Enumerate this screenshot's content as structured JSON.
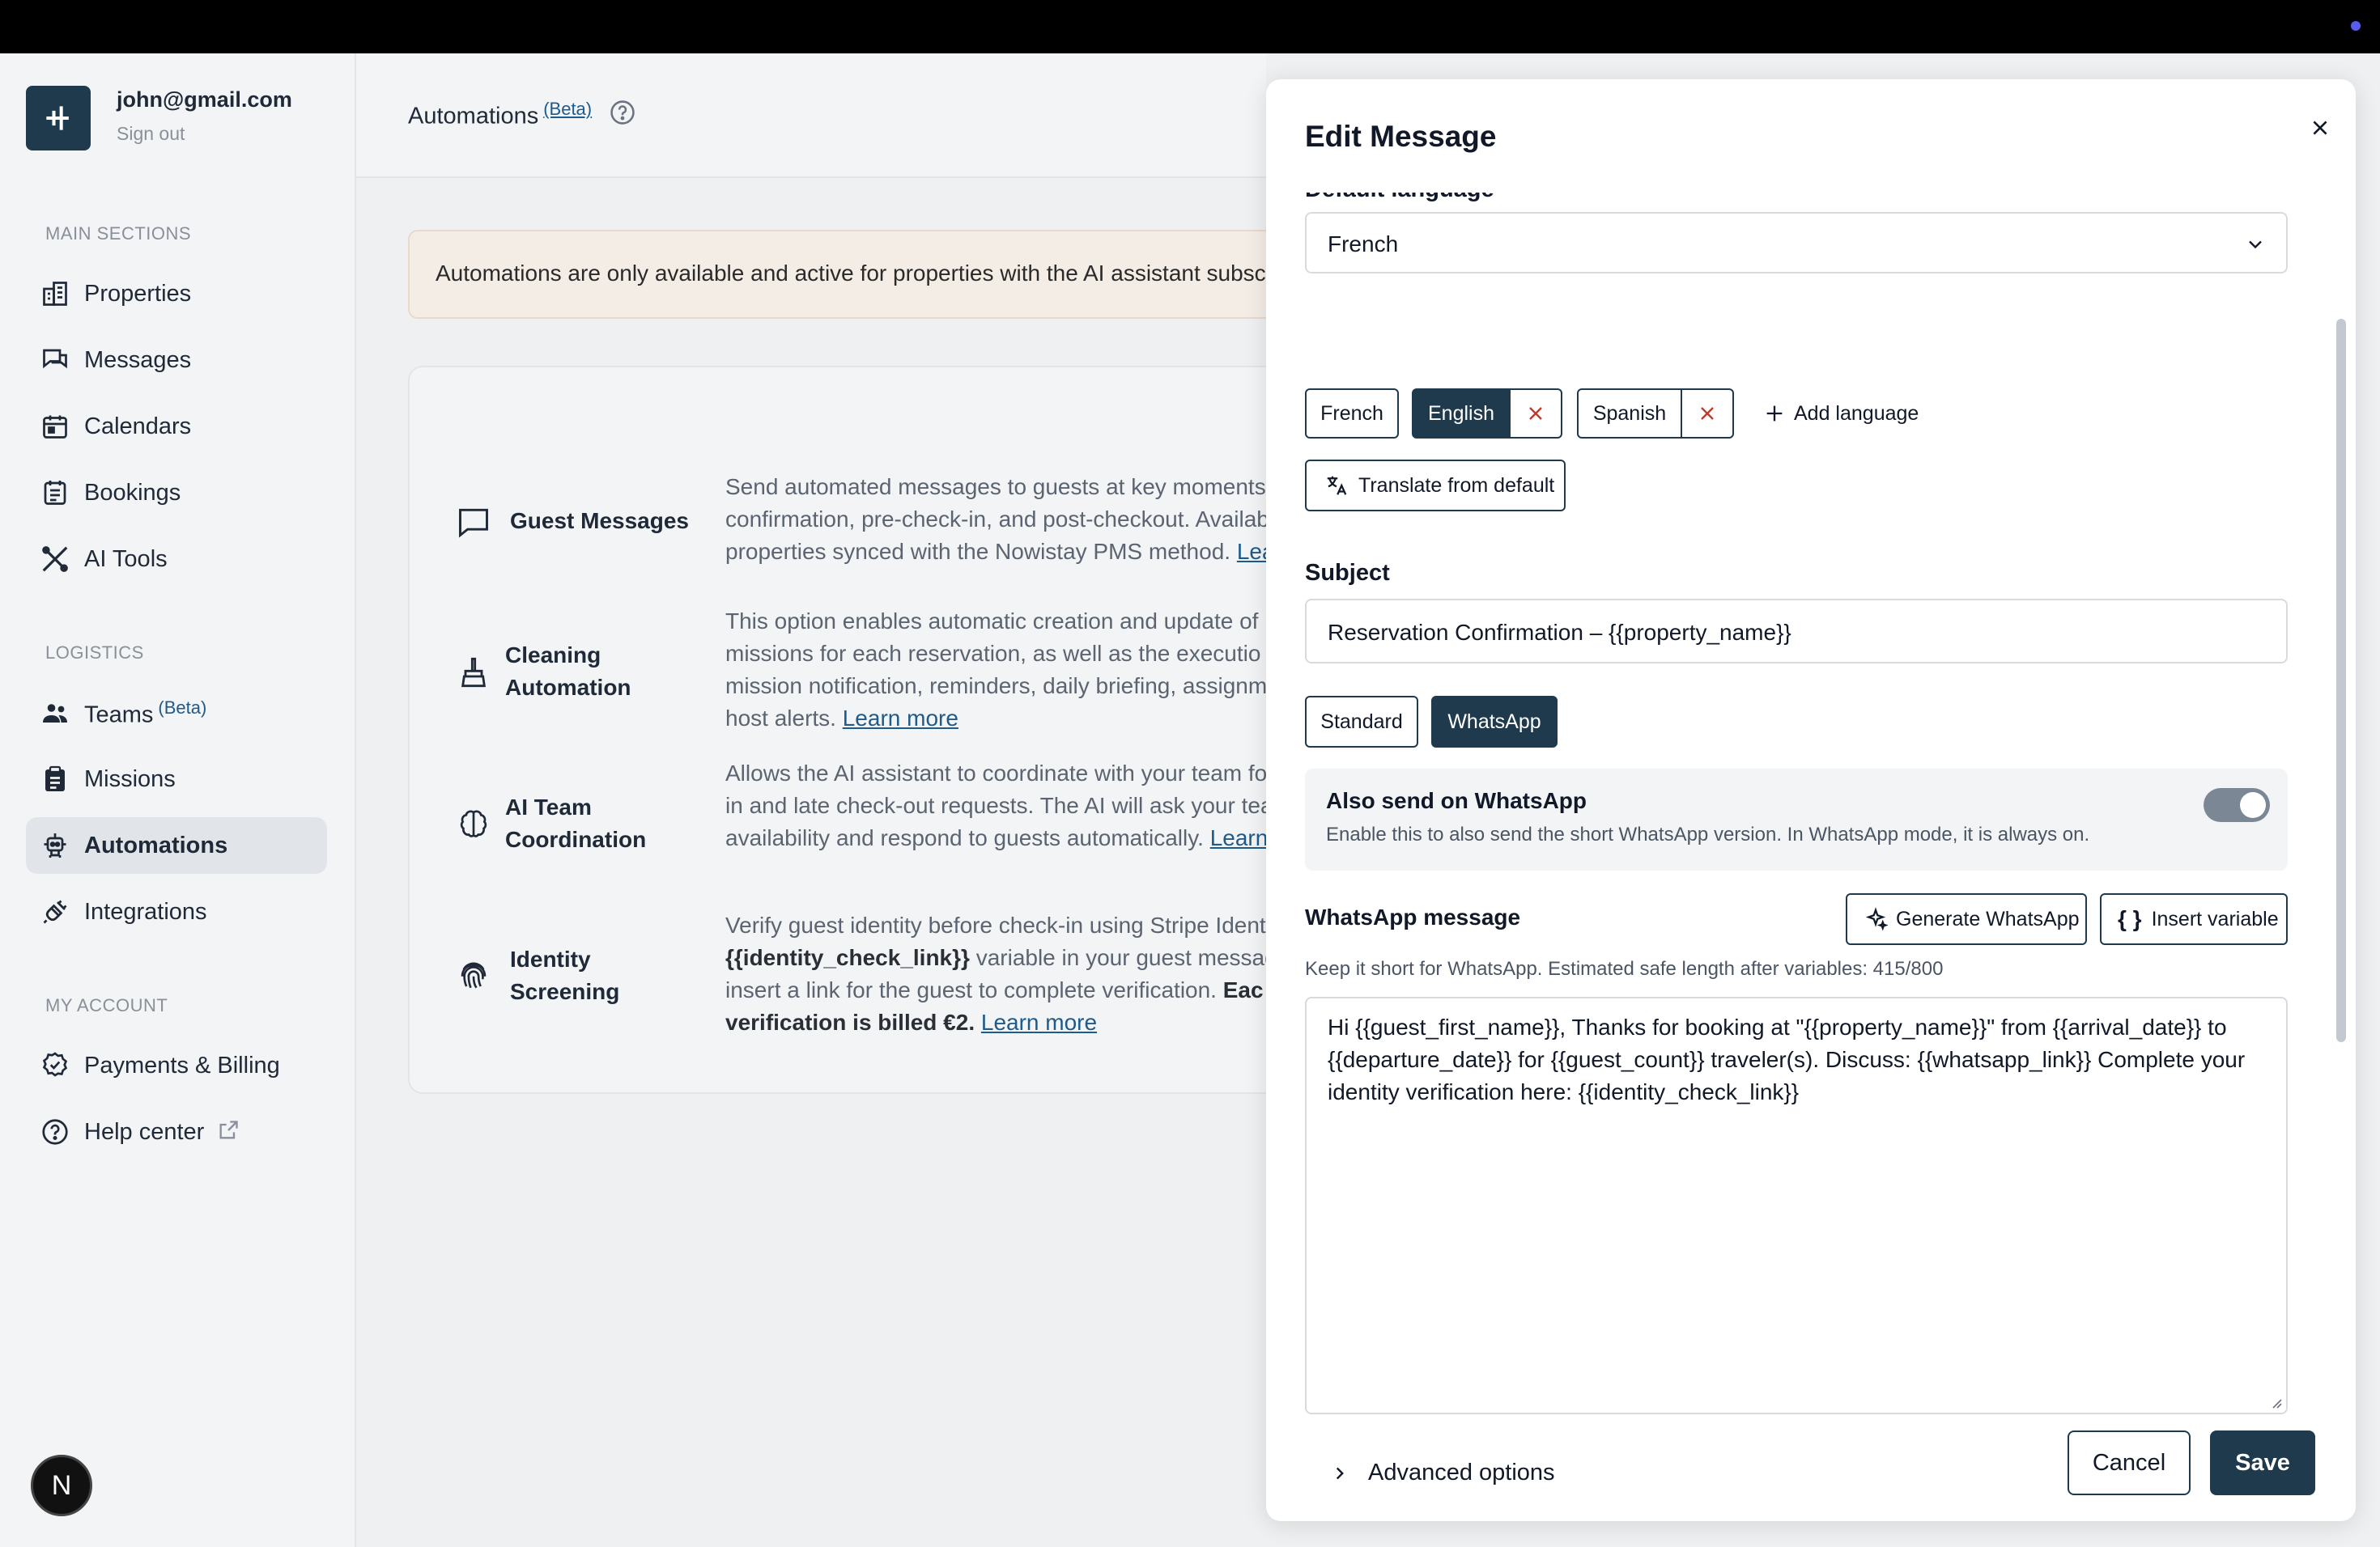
{
  "sidebar": {
    "user_email": "john@gmail.com",
    "sign_out": "Sign out",
    "main_sections_label": "MAIN SECTIONS",
    "logistics_label": "LOGISTICS",
    "my_account_label": "MY ACCOUNT",
    "items": {
      "properties": "Properties",
      "messages": "Messages",
      "calendars": "Calendars",
      "bookings": "Bookings",
      "ai_tools": "AI Tools",
      "teams": "Teams",
      "teams_badge": "(Beta)",
      "missions": "Missions",
      "automations": "Automations",
      "integrations": "Integrations",
      "payments": "Payments & Billing",
      "help": "Help center"
    },
    "avatar_letter": "N"
  },
  "main": {
    "title": "Automations",
    "title_badge": "(Beta)",
    "banner": "Automations are only available and active for properties with the AI assistant subsc",
    "features": {
      "guest": {
        "name": "Guest Messages",
        "line1": "Send automated messages to guests at key moments",
        "line2": "confirmation, pre-check-in, and post-checkout. Availab",
        "line3": "properties synced with the Nowistay PMS method.",
        "link": "Lea"
      },
      "cleaning": {
        "name1": "Cleaning",
        "name2": "Automation",
        "line1": "This option enables automatic creation and update of",
        "line2": "missions for each reservation, as well as the executio",
        "line3": "mission notification, reminders, daily briefing, assignm",
        "line4": "host alerts.",
        "link": "Learn more"
      },
      "team": {
        "name1": "AI Team",
        "name2": "Coordination",
        "line1": "Allows the AI assistant to coordinate with your team fo",
        "line2": "in and late check-out requests. The AI will ask your tea",
        "line3": "availability and respond to guests automatically.",
        "link": "Learn"
      },
      "identity": {
        "name1": "Identity",
        "name2": "Screening",
        "line1": "Verify guest identity before check-in using Stripe Ident",
        "line2_bold": "{{identity_check_link}}",
        "line2_rest": " variable in your guest message",
        "line3": "insert a link for the guest to complete verification.",
        "line3_bold": " Eac",
        "line4_bold": "verification is billed €2.",
        "link": "Learn more"
      }
    }
  },
  "modal": {
    "title": "Edit Message",
    "default_language_label": "Default language",
    "default_language_value": "French",
    "language_chips": [
      "French",
      "English",
      "Spanish"
    ],
    "add_language": "Add language",
    "translate_button": "Translate from default",
    "subject_label": "Subject",
    "subject_value": "Reservation Confirmation – {{property_name}}",
    "mode_tabs": [
      "Standard",
      "WhatsApp"
    ],
    "whatsapp_toggle_title": "Also send on WhatsApp",
    "whatsapp_toggle_desc": "Enable this to also send the short WhatsApp version. In WhatsApp mode, it is always on.",
    "whatsapp_message_label": "WhatsApp message",
    "generate_button": "Generate WhatsApp",
    "insert_variable_button": "Insert variable",
    "hint": "Keep it short for WhatsApp. Estimated safe length after variables: 415/800",
    "message_body": "Hi {{guest_first_name}}, Thanks for booking at \"{{property_name}}\" from {{arrival_date}} to {{departure_date}} for {{guest_count}} traveler(s). Discuss: {{whatsapp_link}} Complete your identity verification here: {{identity_check_link}}",
    "advanced_options": "Advanced options",
    "cancel": "Cancel",
    "save": "Save"
  }
}
